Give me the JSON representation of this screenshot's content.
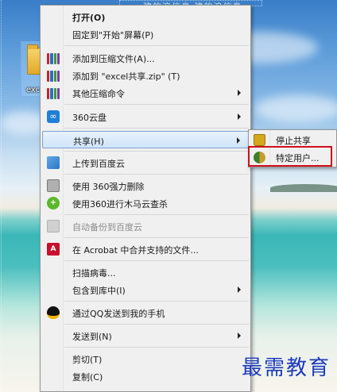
{
  "desktop": {
    "top_text": "建的浪信息  建的浪信息",
    "icon_label": "excel"
  },
  "context_menu": {
    "items": [
      {
        "label": "打开(O)",
        "icon": "none",
        "bold": true
      },
      {
        "label": "固定到\"开始\"屏幕(P)",
        "icon": "none"
      },
      {
        "label": "添加到压缩文件(A)...",
        "icon": "winrar-icon"
      },
      {
        "label": "添加到 \"excel共享.zip\" (T)",
        "icon": "winrar-icon"
      },
      {
        "label": "其他压缩命令",
        "icon": "winrar-icon",
        "submenu": true
      },
      {
        "label": "360云盘",
        "icon": "360-cloud-icon",
        "submenu": true
      },
      {
        "label": "共享(H)",
        "icon": "none",
        "submenu": true,
        "highlighted": true
      },
      {
        "label": "上传到百度云",
        "icon": "baidu-cloud-icon"
      },
      {
        "label": "使用 360强力删除",
        "icon": "shredder-icon"
      },
      {
        "label": "使用360进行木马云查杀",
        "icon": "360-scan-icon"
      },
      {
        "label": "自动备份到百度云",
        "icon": "backup-icon",
        "disabled": true
      },
      {
        "label": "在 Acrobat 中合并支持的文件...",
        "icon": "acrobat-icon"
      },
      {
        "label": "扫描病毒...",
        "icon": "none"
      },
      {
        "label": "包含到库中(I)",
        "icon": "none",
        "submenu": true
      },
      {
        "label": "通过QQ发送到我的手机",
        "icon": "qq-icon"
      },
      {
        "label": "发送到(N)",
        "icon": "none",
        "submenu": true
      },
      {
        "label": "剪切(T)",
        "icon": "none"
      },
      {
        "label": "复制(C)",
        "icon": "none"
      }
    ]
  },
  "share_submenu": {
    "items": [
      {
        "label": "停止共享",
        "icon": "lock-icon"
      },
      {
        "label": "特定用户...",
        "icon": "users-icon",
        "outlined": true
      }
    ]
  },
  "colors": {
    "highlight_border": "#7da2ce",
    "callout_red": "#d0101a",
    "watermark_blue": "#1c3bbd"
  },
  "watermark": "最需教育"
}
